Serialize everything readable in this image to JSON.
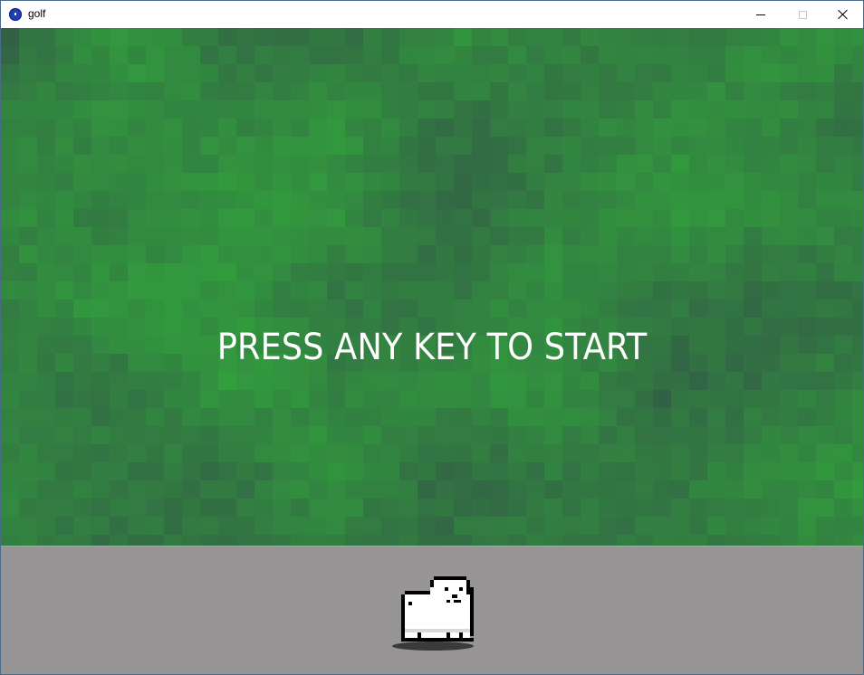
{
  "window": {
    "title": "golf",
    "icon": "app-icon",
    "controls": [
      "minimize-icon",
      "maximize-icon",
      "close-icon"
    ]
  },
  "game": {
    "prompt": "PRESS ANY KEY TO START",
    "character": "white-dog-sprite"
  },
  "colors": {
    "field_base": "#358a48",
    "ground": "#969494",
    "text": "#ffffff"
  }
}
